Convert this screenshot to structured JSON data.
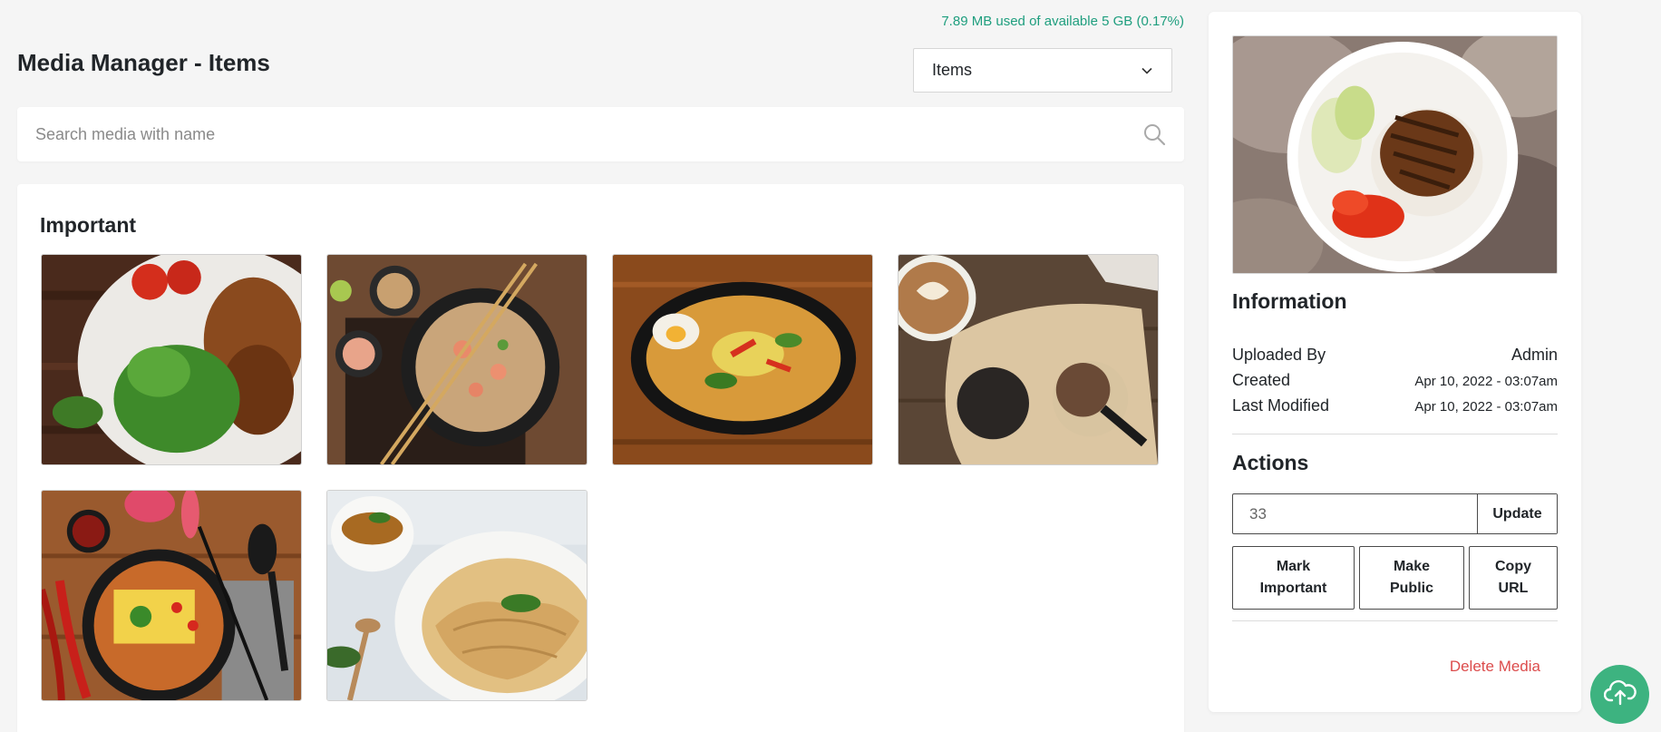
{
  "storage_text": "7.89 MB used of available 5 GB (0.17%)",
  "page_title": "Media Manager - Items",
  "filter": {
    "selected": "Items"
  },
  "search": {
    "placeholder": "Search media with name",
    "value": ""
  },
  "gallery": {
    "section_title": "Important",
    "items": [
      {
        "alt": "roast chicken with salad"
      },
      {
        "alt": "shrimp fried noodles"
      },
      {
        "alt": "curry bowl with egg"
      },
      {
        "alt": "coffee and muffins"
      },
      {
        "alt": "laksa noodle soup"
      },
      {
        "alt": "roti with tea"
      }
    ]
  },
  "details": {
    "information_heading": "Information",
    "uploaded_by_label": "Uploaded By",
    "uploaded_by_value": "Admin",
    "created_label": "Created",
    "created_value": "Apr 10, 2022 - 03:07am",
    "modified_label": "Last Modified",
    "modified_value": "Apr 10, 2022 - 03:07am",
    "actions_heading": "Actions",
    "order_value": "33",
    "update_label": "Update",
    "mark_important_label": "Mark Important",
    "make_public_label": "Make Public",
    "copy_url_label": "Copy URL",
    "delete_label": "Delete Media"
  },
  "colors": {
    "accent_green": "#3db380",
    "storage_green": "#1e9e7e",
    "danger": "#dc4c4c"
  },
  "icons": {
    "search": "search-icon",
    "dropdown": "chevron-down-icon",
    "upload": "cloud-upload-icon"
  }
}
